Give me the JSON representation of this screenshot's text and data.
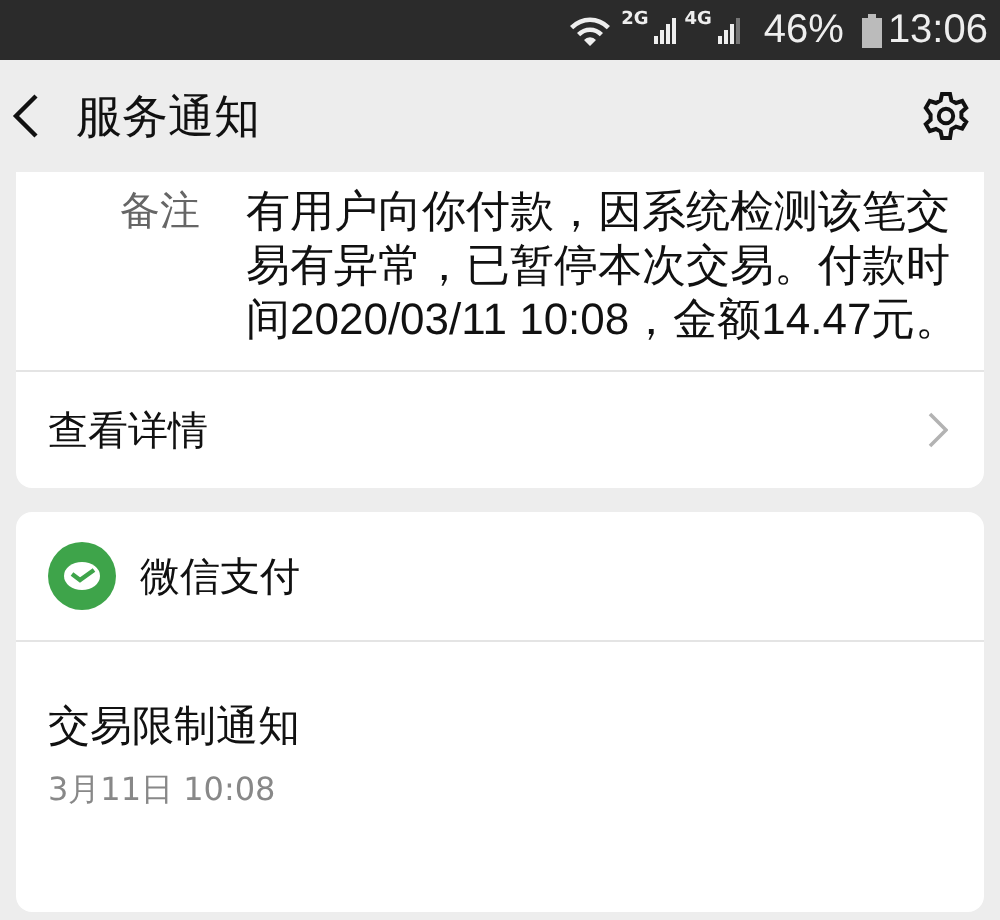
{
  "status_bar": {
    "net_2g": "2G",
    "net_4g": "4G",
    "battery": "46%",
    "time": "13:06"
  },
  "header": {
    "title": "服务通知"
  },
  "note_card": {
    "label": "备注",
    "text": "有用户向你付款，因系统检测该笔交易有异常，已暂停本次交易。付款时间2020/03/11 10:08，金额14.47元。",
    "link": "查看详情"
  },
  "message_card": {
    "sender": "微信支付",
    "title": "交易限制通知",
    "time": "3月11日  10:08"
  }
}
